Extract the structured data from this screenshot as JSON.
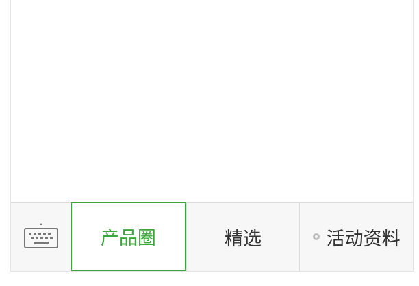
{
  "menu": {
    "keyboard_icon": "keyboard-icon",
    "items": [
      {
        "label": "产品圈",
        "active": true
      },
      {
        "label": "精选",
        "active": false
      },
      {
        "label": "活动资料",
        "active": false,
        "has_submenu": true
      }
    ]
  },
  "colors": {
    "accent": "#3ea63e",
    "text": "#333333",
    "bar_bg": "#f7f7f7",
    "border": "#dcdcdc"
  }
}
